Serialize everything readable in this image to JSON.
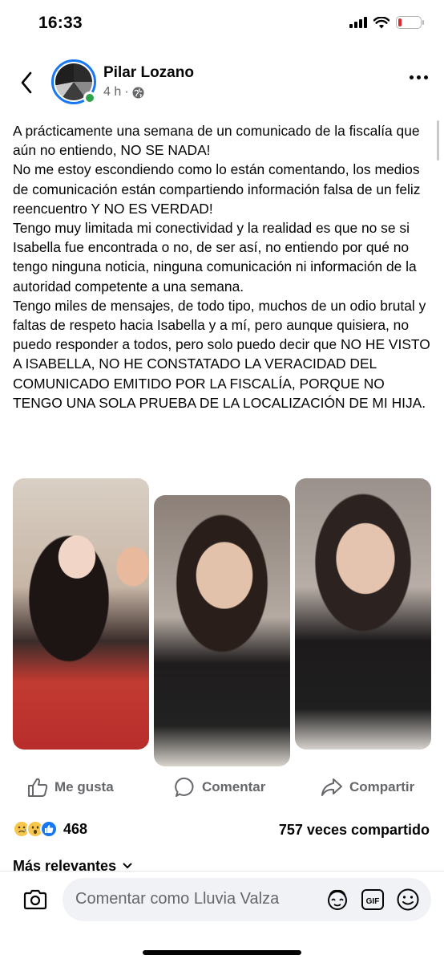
{
  "status_bar": {
    "time": "16:33",
    "battery_level": 0.15,
    "battery_color": "#e0272f"
  },
  "header": {
    "back_icon": "chevron-left-icon",
    "author_name": "Pilar Lozano",
    "time_ago": "4 h",
    "separator": "·",
    "privacy_icon": "globe-icon",
    "more_icon": "more-horizontal-icon",
    "online": true
  },
  "post": {
    "text": "A prácticamente una semana de un comunicado de la fiscalía  que aún no entiendo, NO SE NADA!\nNo me estoy escondiendo como lo están comentando, los medios de comunicación están compartiendo información falsa de un feliz reencuentro Y NO ES VERDAD!\nTengo muy limitada mi conectividad y la realidad es que no se si Isabella fue encontrada o no, de ser así, no entiendo por qué no tengo ninguna noticia, ninguna comunicación ni información de la autoridad competente a una semana.\nTengo miles de mensajes, de todo tipo, muchos de un odio brutal y faltas de respeto hacia Isabella y a mí, pero aunque quisiera, no puedo responder a todos, pero solo puedo decir que NO HE VISTO A ISABELLA, NO HE CONSTATADO LA VERACIDAD DEL COMUNICADO EMITIDO POR LA FISCALÍA, PORQUE NO TENGO UNA SOLA PRUEBA DE LA LOCALIZACIÓN DE MI HIJA.",
    "photos": [
      "photo-woman-and-girl",
      "photo-girl-smiling",
      "photo-girl-closeup"
    ]
  },
  "actions": {
    "like_label": "Me gusta",
    "comment_label": "Comentar",
    "share_label": "Compartir"
  },
  "stats": {
    "reaction_count": "468",
    "reactions": [
      "sad",
      "wow",
      "like"
    ],
    "shares": "757 veces compartido"
  },
  "comments": {
    "sort_label": "Más relevantes"
  },
  "comment_bar": {
    "placeholder": "Comentar como Lluvia Valza",
    "gif_label": "GIF"
  },
  "colors": {
    "accent": "#1877f2",
    "online": "#31a24c",
    "secondary_text": "#65676b"
  }
}
